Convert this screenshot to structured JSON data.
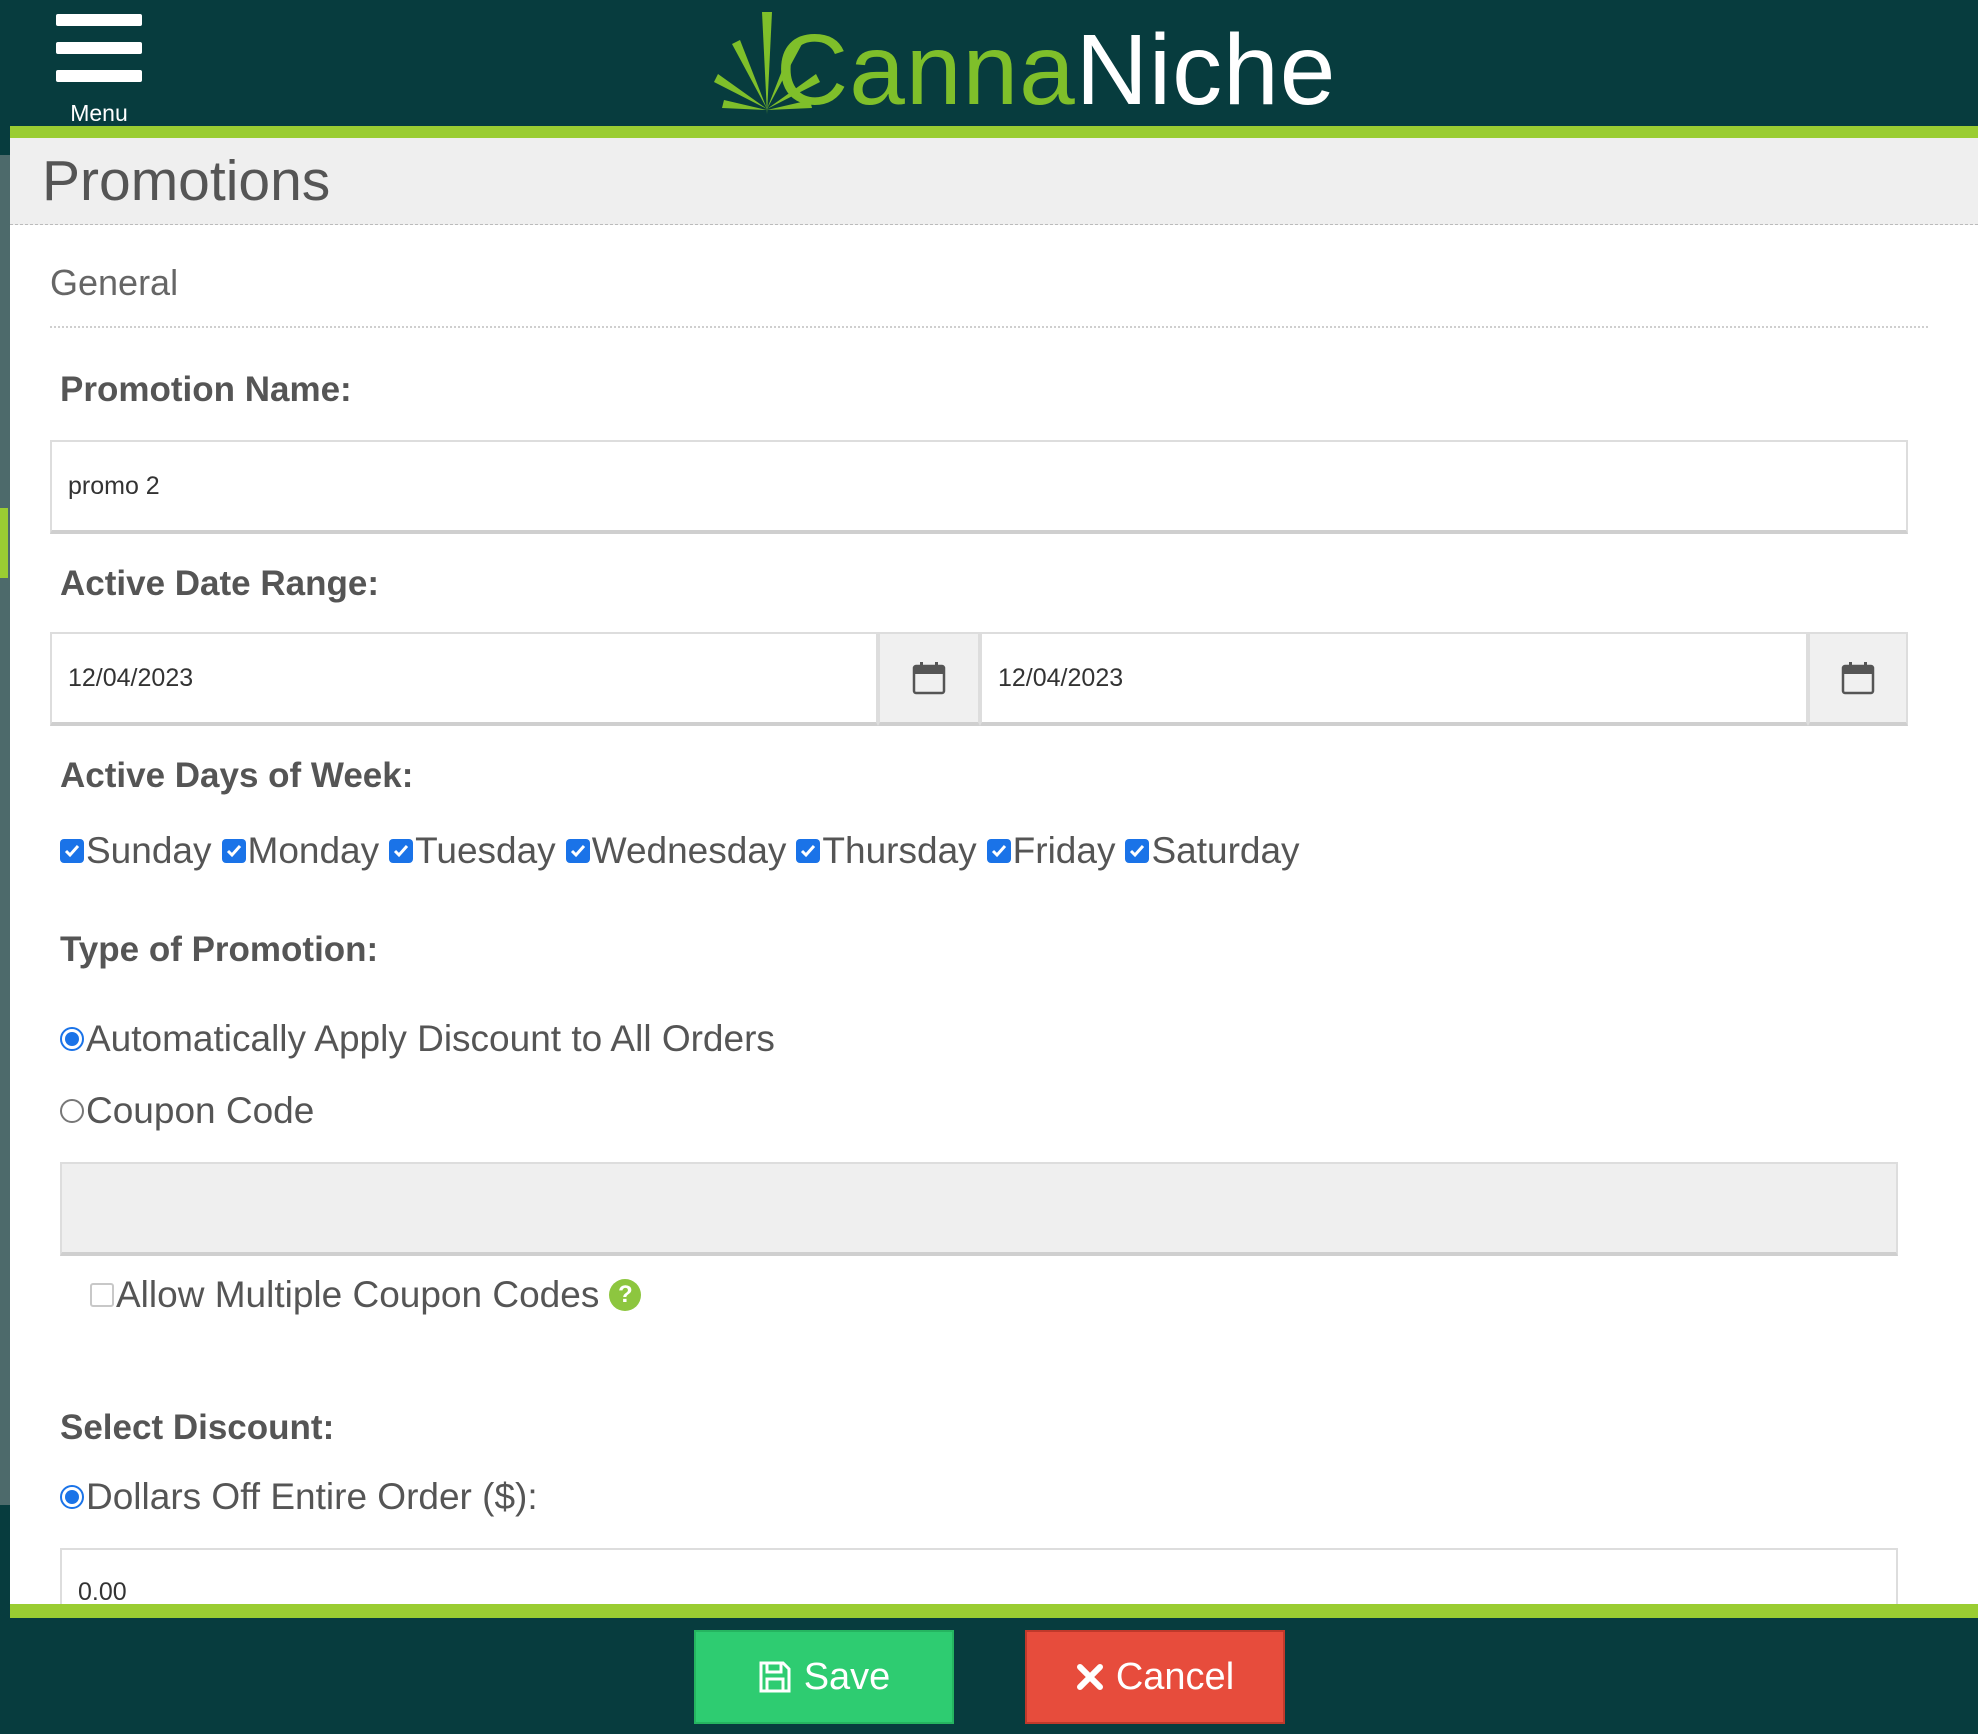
{
  "header": {
    "menu_label": "Menu",
    "logo_part1": "Canna",
    "logo_part2": "Niche"
  },
  "page": {
    "title": "Promotions",
    "section": "General"
  },
  "form": {
    "promotion_name_label": "Promotion Name:",
    "promotion_name_value": "promo 2",
    "date_range_label": "Active Date Range:",
    "start_date": "12/04/2023",
    "end_date": "12/04/2023",
    "days_label": "Active Days of Week:",
    "days": [
      {
        "label": "Sunday",
        "checked": true
      },
      {
        "label": "Monday",
        "checked": true
      },
      {
        "label": "Tuesday",
        "checked": true
      },
      {
        "label": "Wednesday",
        "checked": true
      },
      {
        "label": "Thursday",
        "checked": true
      },
      {
        "label": "Friday",
        "checked": true
      },
      {
        "label": "Saturday",
        "checked": true
      }
    ],
    "promo_type_label": "Type of Promotion:",
    "promo_type_options": [
      {
        "label": "Automatically Apply Discount to All Orders",
        "selected": true
      },
      {
        "label": "Coupon Code",
        "selected": false
      }
    ],
    "coupon_code_value": "",
    "allow_multiple_label": "Allow Multiple Coupon Codes",
    "allow_multiple_checked": false,
    "help_glyph": "?",
    "select_discount_label": "Select Discount:",
    "discount_option": {
      "label": "Dollars Off Entire Order ($):",
      "selected": true
    },
    "discount_value": "0.00"
  },
  "footer": {
    "save_label": "Save",
    "cancel_label": "Cancel"
  },
  "colors": {
    "header_bg": "#073c3e",
    "accent_green": "#9acd32",
    "save_green": "#2ecc71",
    "cancel_red": "#e74c3c",
    "checkbox_blue": "#1a73e8"
  }
}
